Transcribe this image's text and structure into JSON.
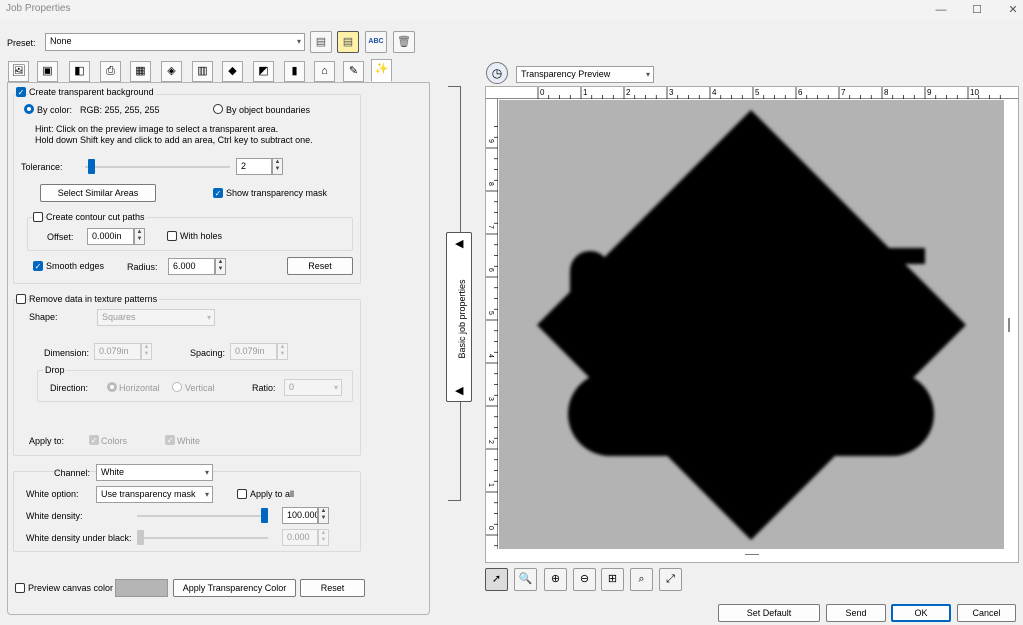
{
  "window": {
    "title": "Job Properties",
    "min_icon": "minimize-icon",
    "max_icon": "maximize-icon",
    "close_icon": "close-icon"
  },
  "preset": {
    "label": "Preset:",
    "value": "None"
  },
  "toolbar": {
    "rename_label": "ABC"
  },
  "transparency": {
    "create_label": "Create transparent background",
    "create_checked": true,
    "by_color_label": "By color:",
    "rgb_value": "RGB: 255, 255, 255",
    "by_boundaries_label": "By object boundaries",
    "hint_line1": "Hint: Click on the preview image to select a transparent area.",
    "hint_line2": "Hold down Shift key and click to add an area, Ctrl key to subtract one.",
    "tolerance_label": "Tolerance:",
    "tolerance_value": "2",
    "tolerance_fraction": 0.02,
    "select_similar_label": "Select Similar Areas",
    "show_mask_label": "Show transparency mask",
    "show_mask_checked": true,
    "contour_label": "Create contour cut paths",
    "contour_checked": false,
    "offset_label": "Offset:",
    "offset_value": "0.000in",
    "with_holes_label": "With holes",
    "smooth_label": "Smooth edges",
    "smooth_checked": true,
    "radius_label": "Radius:",
    "radius_value": "6.000",
    "reset_label": "Reset"
  },
  "texture": {
    "remove_label": "Remove data in texture patterns",
    "shape_label": "Shape:",
    "shape_value": "Squares",
    "dimension_label": "Dimension:",
    "dimension_value": "0.079in",
    "spacing_label": "Spacing:",
    "spacing_value": "0.079in",
    "drop_label": "Drop",
    "direction_label": "Direction:",
    "horizontal_label": "Horizontal",
    "vertical_label": "Vertical",
    "ratio_label": "Ratio:",
    "ratio_value": "0",
    "apply_to_label": "Apply to:",
    "colors_label": "Colors",
    "white_label": "White"
  },
  "white": {
    "channel_label": "Channel:",
    "channel_value": "White",
    "option_label": "White option:",
    "option_value": "Use transparency mask",
    "apply_all_label": "Apply to all",
    "density_label": "White density:",
    "density_value": "100.000",
    "density_fraction": 1.0,
    "under_black_label": "White density under black:",
    "under_black_value": "0.000",
    "under_black_fraction": 0.0
  },
  "bottom": {
    "preview_canvas_label": "Preview canvas color",
    "apply_color_label": "Apply Transparency Color",
    "reset_label": "Reset"
  },
  "splitter": {
    "label": "Basic job properties"
  },
  "preview": {
    "mode_value": "Transparency Preview",
    "ruler_h": [
      "0",
      "1",
      "2",
      "3",
      "4",
      "5",
      "6",
      "7",
      "8",
      "9",
      "10"
    ],
    "ruler_v": [
      "9",
      "8",
      "7",
      "6",
      "5",
      "4",
      "3",
      "2",
      "1",
      "0"
    ]
  },
  "footer": {
    "set_default_label": "Set Default",
    "send_label": "Send",
    "ok_label": "OK",
    "cancel_label": "Cancel"
  }
}
